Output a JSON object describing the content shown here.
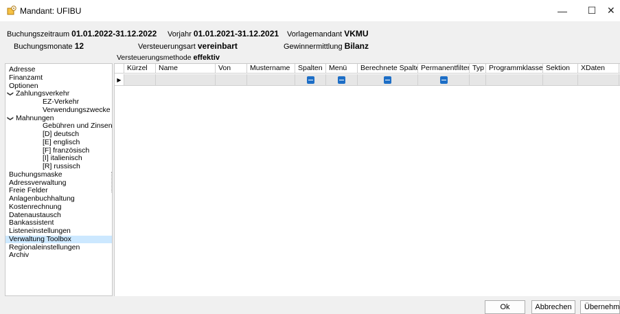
{
  "window": {
    "title": "Mandant: UFIBU",
    "minimize": "—",
    "maximize": "☐",
    "close": "✕"
  },
  "header": {
    "buchungszeitraum_label": "Buchungszeitraum",
    "buchungszeitraum_value": "01.01.2022-31.12.2022",
    "vorjahr_label": "Vorjahr",
    "vorjahr_value": "01.01.2021-31.12.2021",
    "vorlagemandant_label": "Vorlagemandant",
    "vorlagemandant_value": "VKMU",
    "buchungsmonate_label": "Buchungsmonate",
    "buchungsmonate_value": "12",
    "versteuerungsart_label": "Versteuerungsart",
    "versteuerungsart_value": "vereinbart",
    "gewinnermittlung_label": "Gewinnermittlung",
    "gewinnermittlung_value": "Bilanz",
    "versteuerungsmethode_label": "Versteuerungsmethode",
    "versteuerungsmethode_value": "effektiv"
  },
  "sidebar": {
    "items": [
      {
        "label": "Adresse",
        "level": 0
      },
      {
        "label": "Finanzamt",
        "level": 0
      },
      {
        "label": "Optionen",
        "level": 0
      },
      {
        "label": "Zahlungsverkehr",
        "level": 0,
        "expanded": true
      },
      {
        "label": "EZ-Verkehr",
        "level": 1
      },
      {
        "label": "Verwendungszwecke",
        "level": 1
      },
      {
        "label": "Mahnungen",
        "level": 0,
        "expanded": true
      },
      {
        "label": "Gebühren und Zinsen",
        "level": 1
      },
      {
        "label": "[D] deutsch",
        "level": 1
      },
      {
        "label": "[E] englisch",
        "level": 1
      },
      {
        "label": "[F] französisch",
        "level": 1
      },
      {
        "label": "[I] italienisch",
        "level": 1
      },
      {
        "label": "[R] russisch",
        "level": 1
      },
      {
        "label": "Buchungsmaske",
        "level": 0
      },
      {
        "label": "Adressverwaltung",
        "level": 0
      },
      {
        "label": "Freie Felder",
        "level": 0
      },
      {
        "label": "Anlagenbuchhaltung",
        "level": 0
      },
      {
        "label": "Kostenrechnung",
        "level": 0
      },
      {
        "label": "Datenaustausch",
        "level": 0
      },
      {
        "label": "Bankassistent",
        "level": 0
      },
      {
        "label": "Listeneinstellungen",
        "level": 0
      },
      {
        "label": "Verwaltung Toolbox",
        "level": 0,
        "selected": true
      },
      {
        "label": "Regionaleinstellungen",
        "level": 0
      },
      {
        "label": "Archiv",
        "level": 0
      }
    ],
    "expand_glyph": "❯"
  },
  "grid": {
    "columns": [
      "Kürzel",
      "Name",
      "Von",
      "Mustername",
      "Spalten",
      "Menü",
      "Berechnete Spalten",
      "Permanentfilter",
      "Typ",
      "Programmklasse",
      "Sektion",
      "XDaten"
    ],
    "row_indicator": "▶",
    "new_row_checkboxes": [
      "Spalten",
      "Menü",
      "Berechnete Spalten",
      "Permanentfilter"
    ],
    "checkbox_state": "indeterminate",
    "accent_color": "#1d6ec6"
  },
  "footer": {
    "ok": "Ok",
    "cancel": "Abbrechen",
    "apply": "Übernehmen"
  },
  "colors": {
    "selection": "#cce8ff",
    "new_row": "#e6e6e6"
  }
}
